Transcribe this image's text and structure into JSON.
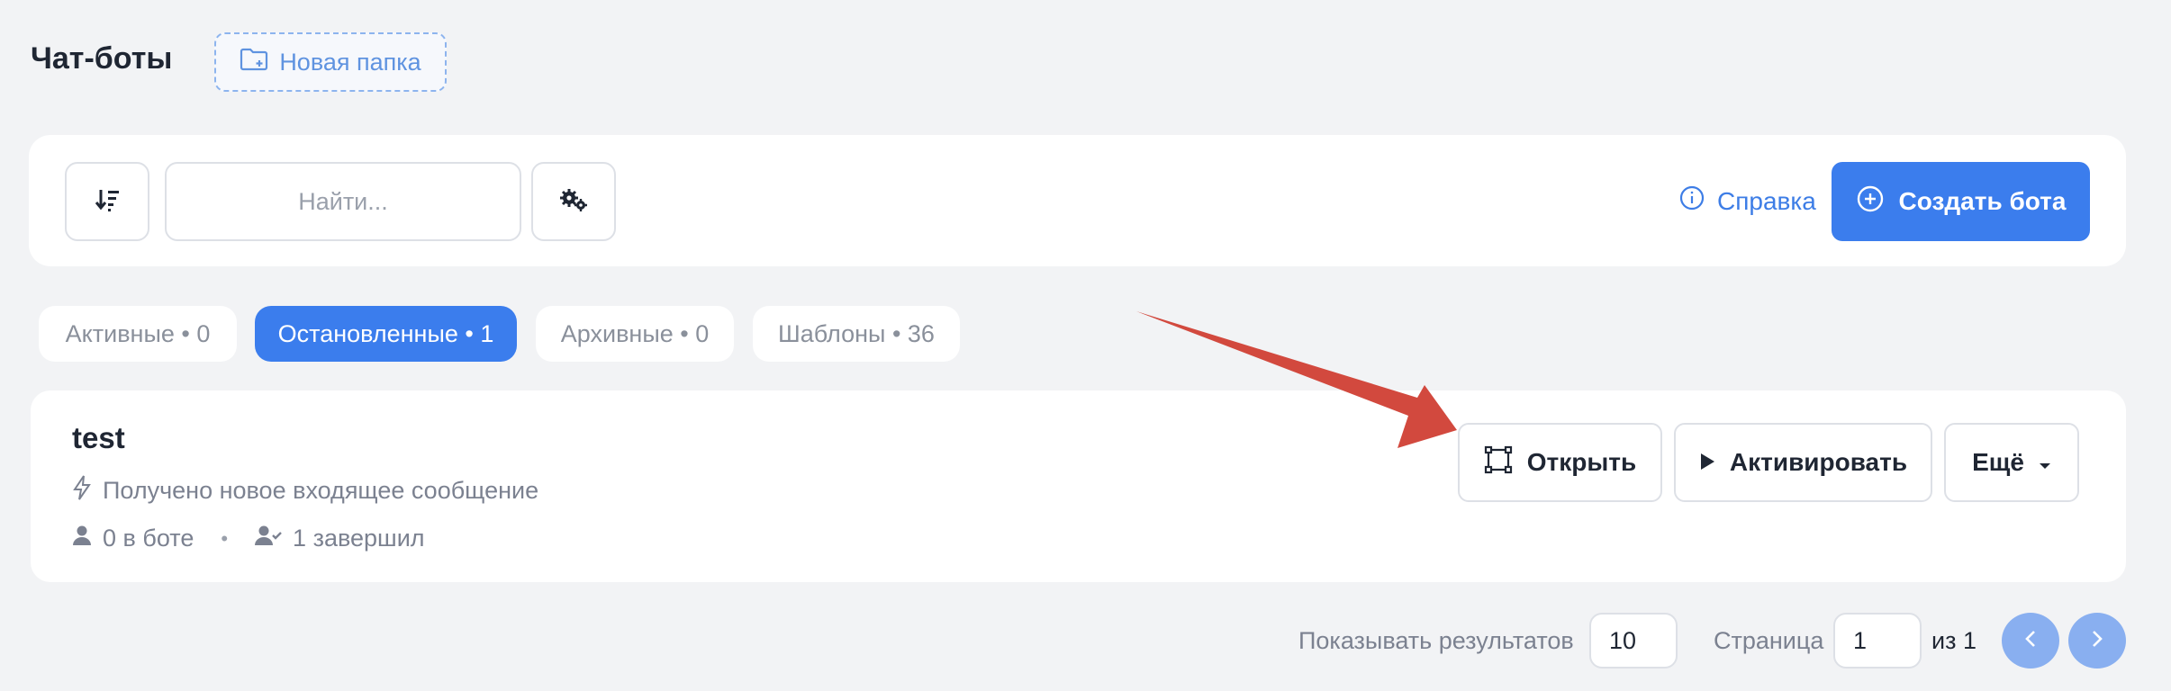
{
  "header": {
    "title": "Чат-боты",
    "new_folder_label": "Новая папка"
  },
  "toolbar": {
    "search_placeholder": "Найти...",
    "help_label": "Справка",
    "create_label": "Создать бота"
  },
  "tabs": [
    {
      "label": "Активные • 0",
      "active": false
    },
    {
      "label": "Остановленные • 1",
      "active": true
    },
    {
      "label": "Архивные • 0",
      "active": false
    },
    {
      "label": "Шаблоны • 36",
      "active": false
    }
  ],
  "bot": {
    "name": "test",
    "trigger": "Получено новое входящее сообщение",
    "in_bot": "0 в боте",
    "finished": "1 завершил",
    "open_label": "Открыть",
    "activate_label": "Активировать",
    "more_label": "Ещё"
  },
  "pagination": {
    "show_label": "Показывать результатов",
    "per_page": "10",
    "page_label": "Страница",
    "page": "1",
    "of_label": "из 1"
  },
  "colors": {
    "accent": "#3b7ded",
    "annotation_arrow": "#d2493e"
  },
  "icons": {
    "sort": "sort-icon",
    "settings": "gears-icon",
    "help": "info-icon",
    "create": "plus-circle-icon",
    "open": "expand-frame-icon",
    "activate": "play-icon",
    "more": "caret-down-icon"
  }
}
